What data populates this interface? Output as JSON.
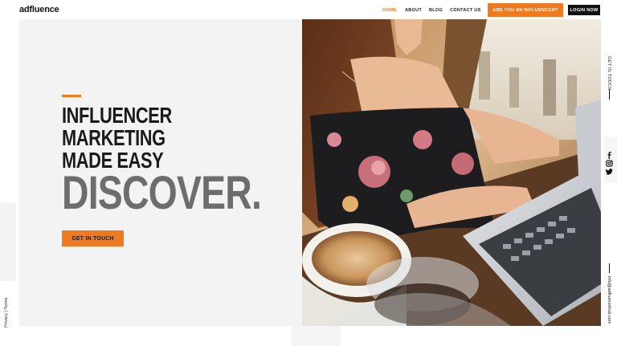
{
  "brand": {
    "logo": "adfluence"
  },
  "nav": {
    "items": [
      {
        "label": "HOME",
        "active": true
      },
      {
        "label": "ABOUT"
      },
      {
        "label": "BLOG"
      },
      {
        "label": "CONTACT US"
      }
    ],
    "cta_influencer": "ARE YOU AN INFLUENCER?",
    "cta_login": "LOGIN NOW"
  },
  "hero": {
    "headline_lines": [
      "INFLUENCER",
      "MARKETING",
      "MADE EASY"
    ],
    "highlight": "DISCOVER.",
    "button": "GET IN TOUCH"
  },
  "side": {
    "get_in_touch": "GET IN TOUCH",
    "email": "info@adfluencehub.com",
    "privacy": "Privacy",
    "separator": " | ",
    "terms": "Terms",
    "socials": [
      "facebook-icon",
      "instagram-icon",
      "twitter-icon"
    ]
  },
  "colors": {
    "accent": "#f07a22",
    "dark": "#1b1b1b",
    "panel": "#f3f3f3"
  }
}
